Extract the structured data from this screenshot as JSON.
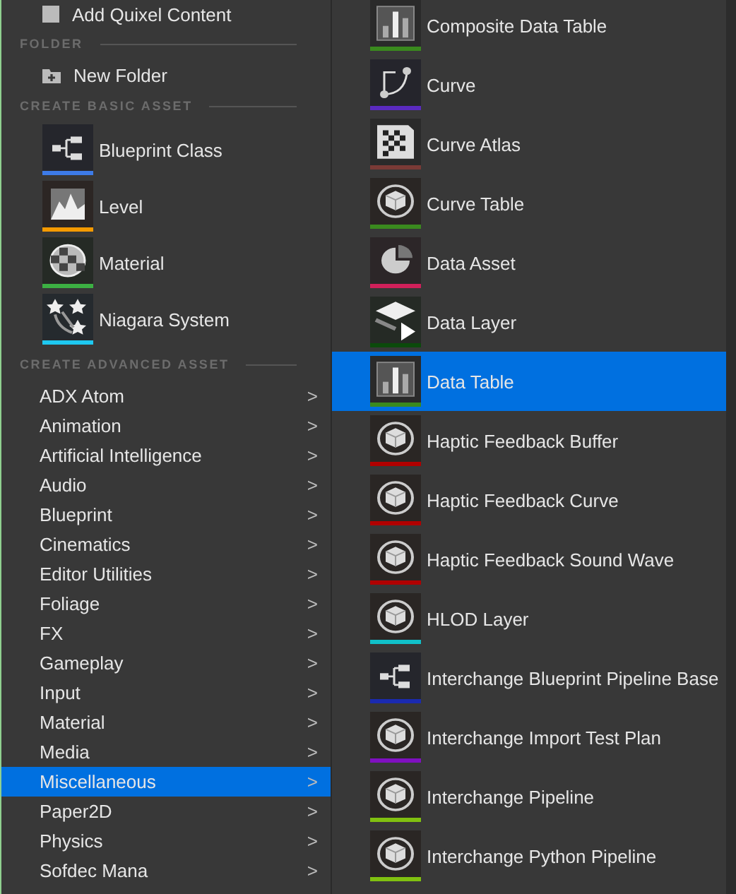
{
  "left_menu": {
    "top_item": {
      "label": "Add Quixel Content"
    },
    "folder_section": {
      "title": "FOLDER",
      "items": [
        {
          "label": "New Folder"
        }
      ]
    },
    "basic_section": {
      "title": "CREATE BASIC ASSET",
      "items": [
        {
          "label": "Blueprint Class",
          "kind": "blueprint",
          "color": "#3d7be8"
        },
        {
          "label": "Level",
          "kind": "level",
          "color": "#f59a00"
        },
        {
          "label": "Material",
          "kind": "material",
          "color": "#3cb043"
        },
        {
          "label": "Niagara System",
          "kind": "niagara",
          "color": "#1ec8f0"
        }
      ]
    },
    "advanced_section": {
      "title": "CREATE ADVANCED ASSET",
      "categories": [
        {
          "label": "ADX Atom",
          "chevron": ">",
          "selected": false
        },
        {
          "label": "Animation",
          "chevron": ">",
          "selected": false
        },
        {
          "label": "Artificial Intelligence",
          "chevron": ">",
          "selected": false
        },
        {
          "label": "Audio",
          "chevron": ">",
          "selected": false
        },
        {
          "label": "Blueprint",
          "chevron": ">",
          "selected": false
        },
        {
          "label": "Cinematics",
          "chevron": ">",
          "selected": false
        },
        {
          "label": "Editor Utilities",
          "chevron": ">",
          "selected": false
        },
        {
          "label": "Foliage",
          "chevron": ">",
          "selected": false
        },
        {
          "label": "FX",
          "chevron": ">",
          "selected": false
        },
        {
          "label": "Gameplay",
          "chevron": ">",
          "selected": false
        },
        {
          "label": "Input",
          "chevron": ">",
          "selected": false
        },
        {
          "label": "Material",
          "chevron": ">",
          "selected": false
        },
        {
          "label": "Media",
          "chevron": ">",
          "selected": false
        },
        {
          "label": "Miscellaneous",
          "chevron": ">",
          "selected": true
        },
        {
          "label": "Paper2D",
          "chevron": ">",
          "selected": false
        },
        {
          "label": "Physics",
          "chevron": ">",
          "selected": false
        },
        {
          "label": "Sofdec Mana",
          "chevron": ">",
          "selected": false
        }
      ]
    }
  },
  "submenu": {
    "items": [
      {
        "label": "Composite Data Table",
        "kind": "chart",
        "color": "#3a8a1e",
        "selected": false
      },
      {
        "label": "Curve",
        "kind": "curve",
        "color": "#5a2ac0",
        "selected": false
      },
      {
        "label": "Curve Atlas",
        "kind": "checker",
        "color": "#7a3a36",
        "selected": false
      },
      {
        "label": "Curve Table",
        "kind": "cube",
        "color": "#3a8a1e",
        "selected": false
      },
      {
        "label": "Data Asset",
        "kind": "pie",
        "color": "#d0205a",
        "selected": false
      },
      {
        "label": "Data Layer",
        "kind": "layer",
        "color": "#0b4a0b",
        "selected": false
      },
      {
        "label": "Data Table",
        "kind": "chart",
        "color": "#3a8a1e",
        "selected": true
      },
      {
        "label": "Haptic Feedback Buffer",
        "kind": "cube",
        "color": "#b00000",
        "selected": false
      },
      {
        "label": "Haptic Feedback Curve",
        "kind": "cube",
        "color": "#b00000",
        "selected": false
      },
      {
        "label": "Haptic Feedback Sound Wave",
        "kind": "cube",
        "color": "#b00000",
        "selected": false
      },
      {
        "label": "HLOD Layer",
        "kind": "cube",
        "color": "#10c0c8",
        "selected": false
      },
      {
        "label": "Interchange Blueprint Pipeline Base",
        "kind": "blueprint",
        "color": "#1a2ab0",
        "selected": false
      },
      {
        "label": "Interchange Import Test Plan",
        "kind": "cube",
        "color": "#8010c0",
        "selected": false
      },
      {
        "label": "Interchange Pipeline",
        "kind": "cube",
        "color": "#80c010",
        "selected": false
      },
      {
        "label": "Interchange Python Pipeline",
        "kind": "cube",
        "color": "#80c010",
        "selected": false
      }
    ]
  }
}
